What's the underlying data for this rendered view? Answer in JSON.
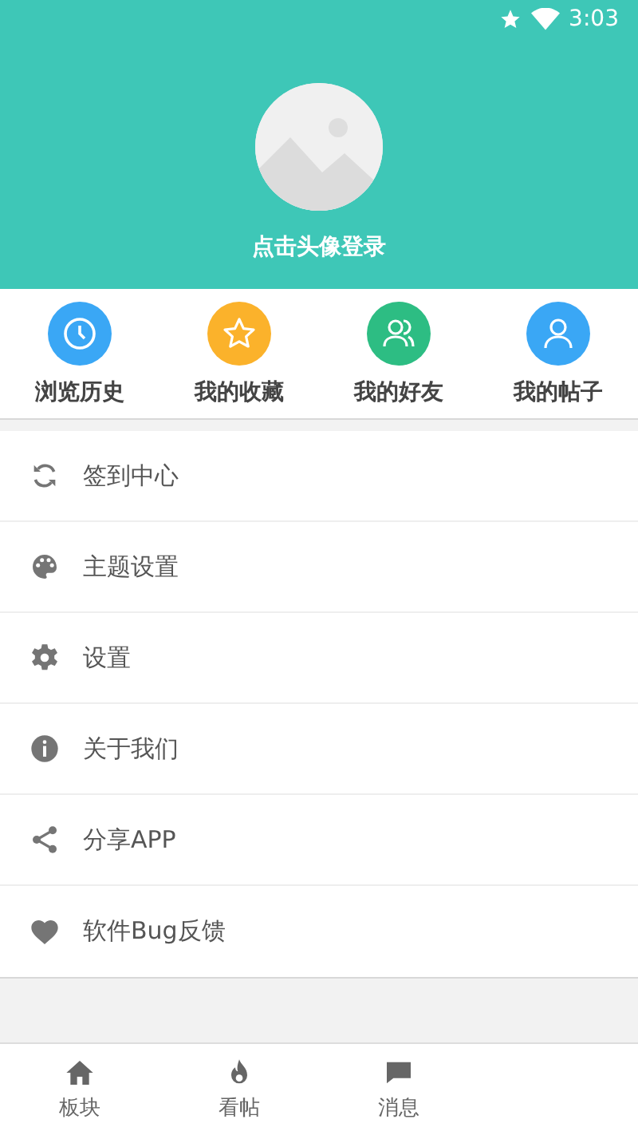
{
  "status_bar": {
    "time": "3:03"
  },
  "profile": {
    "login_label": "点击头像登录"
  },
  "shortcuts": [
    {
      "label": "浏览历史",
      "kind": "clock",
      "color": "#3aa7f5"
    },
    {
      "label": "我的收藏",
      "kind": "star",
      "color": "#fbb22b"
    },
    {
      "label": "我的好友",
      "kind": "friends",
      "color": "#2dbd83"
    },
    {
      "label": "我的帖子",
      "kind": "user",
      "color": "#3aa7f5"
    }
  ],
  "menu": [
    {
      "label": "签到中心",
      "kind": "sync"
    },
    {
      "label": "主题设置",
      "kind": "palette"
    },
    {
      "label": "设置",
      "kind": "gear"
    },
    {
      "label": "关于我们",
      "kind": "info"
    },
    {
      "label": "分享APP",
      "kind": "share"
    },
    {
      "label": "软件Bug反馈",
      "kind": "heart"
    }
  ],
  "bottom_nav": [
    {
      "label": "板块",
      "kind": "home"
    },
    {
      "label": "看帖",
      "kind": "flame"
    },
    {
      "label": "消息",
      "kind": "message"
    }
  ]
}
